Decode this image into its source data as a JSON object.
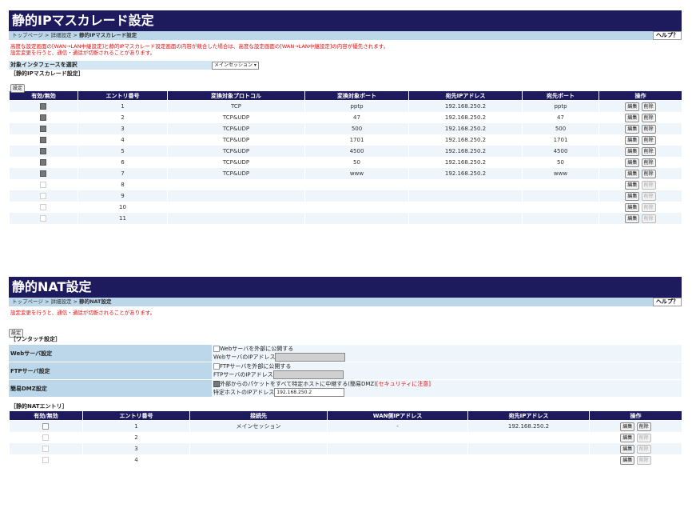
{
  "masq": {
    "title": "静的IPマスカレード設定",
    "breadcrumb": {
      "top": "トップページ",
      "sep": " > ",
      "mid": "詳細設定",
      "current": "静的IPマスカレード設定"
    },
    "help": "ヘルプ？",
    "warning_line1": "高度な設定画面の[WAN→LAN中継設定]と静的IPマスカレード設定画面の内容が競合した場合は、高度な設定画面の[WAN→LAN中継設定]の内容が優先されます。",
    "warning_line2": "設定変更を行うと、通信・通話が切断されることがあります。",
    "iface_label": "対象インタフェースを選択",
    "iface_value": "メインセッション ▾",
    "section_label": "［静的IPマスカレード設定］",
    "set_button": "設定",
    "headers": [
      "有効/無効",
      "エントリ番号",
      "変換対象プロトコル",
      "変換対象ポート",
      "宛先IPアドレス",
      "宛先ポート",
      "操作"
    ],
    "edit_label": "編集",
    "delete_label": "削除",
    "rows": [
      {
        "enabled": true,
        "no": "1",
        "protocol": "TCP",
        "port": "pptp",
        "ip": "192.168.250.2",
        "dest_port": "pptp"
      },
      {
        "enabled": true,
        "no": "2",
        "protocol": "TCP&UDP",
        "port": "47",
        "ip": "192.168.250.2",
        "dest_port": "47"
      },
      {
        "enabled": true,
        "no": "3",
        "protocol": "TCP&UDP",
        "port": "500",
        "ip": "192.168.250.2",
        "dest_port": "500"
      },
      {
        "enabled": true,
        "no": "4",
        "protocol": "TCP&UDP",
        "port": "1701",
        "ip": "192.168.250.2",
        "dest_port": "1701"
      },
      {
        "enabled": true,
        "no": "5",
        "protocol": "TCP&UDP",
        "port": "4500",
        "ip": "192.168.250.2",
        "dest_port": "4500"
      },
      {
        "enabled": true,
        "no": "6",
        "protocol": "TCP&UDP",
        "port": "50",
        "ip": "192.168.250.2",
        "dest_port": "50"
      },
      {
        "enabled": true,
        "no": "7",
        "protocol": "TCP&UDP",
        "port": "www",
        "ip": "192.168.250.2",
        "dest_port": "www"
      },
      {
        "enabled": false,
        "no": "8",
        "protocol": "",
        "port": "",
        "ip": "",
        "dest_port": ""
      },
      {
        "enabled": false,
        "no": "9",
        "protocol": "",
        "port": "",
        "ip": "",
        "dest_port": ""
      },
      {
        "enabled": false,
        "no": "10",
        "protocol": "",
        "port": "",
        "ip": "",
        "dest_port": ""
      },
      {
        "enabled": false,
        "no": "11",
        "protocol": "",
        "port": "",
        "ip": "",
        "dest_port": ""
      }
    ]
  },
  "nat": {
    "title": "静的NAT設定",
    "breadcrumb": {
      "top": "トップページ",
      "sep": " > ",
      "mid": "詳細設定",
      "current": "静的NAT設定"
    },
    "help": "ヘルプ？",
    "warning": "設定変更を行うと、通信・通話が切断されることがあります。",
    "set_button": "設定",
    "onetouch_label": "［ワンタッチ設定］",
    "web_label": "Webサーバ設定",
    "web_checkbox": "Webサーバを外部に公開する",
    "web_ip_label": "WebサーバのIPアドレス",
    "web_ip_value": "",
    "ftp_label": "FTPサーバ設定",
    "ftp_checkbox": "FTPサーバを外部に公開する",
    "ftp_ip_label": "FTPサーバのIPアドレス",
    "ftp_ip_value": "",
    "dmz_label": "簡易DMZ設定",
    "dmz_checkbox": "外部からのパケットをすべて特定ホストに中継する(簡易DMZ)",
    "dmz_warning": "[セキュリティに注意]",
    "dmz_ip_label": "特定ホストのIPアドレス",
    "dmz_ip_value": "192.168.250.2",
    "entries_label": "［静的NATエントリ］",
    "headers": [
      "有効/無効",
      "エントリ番号",
      "接続先",
      "WAN側IPアドレス",
      "宛先IPアドレス",
      "操作"
    ],
    "edit_label": "編集",
    "delete_label": "削除",
    "rows": [
      {
        "enabled": true,
        "no": "1",
        "dest": "メインセッション",
        "wan_ip": "-",
        "ip": "192.168.250.2"
      },
      {
        "enabled": false,
        "no": "2",
        "dest": "",
        "wan_ip": "",
        "ip": ""
      },
      {
        "enabled": false,
        "no": "3",
        "dest": "",
        "wan_ip": "",
        "ip": ""
      },
      {
        "enabled": false,
        "no": "4",
        "dest": "",
        "wan_ip": "",
        "ip": ""
      }
    ]
  }
}
